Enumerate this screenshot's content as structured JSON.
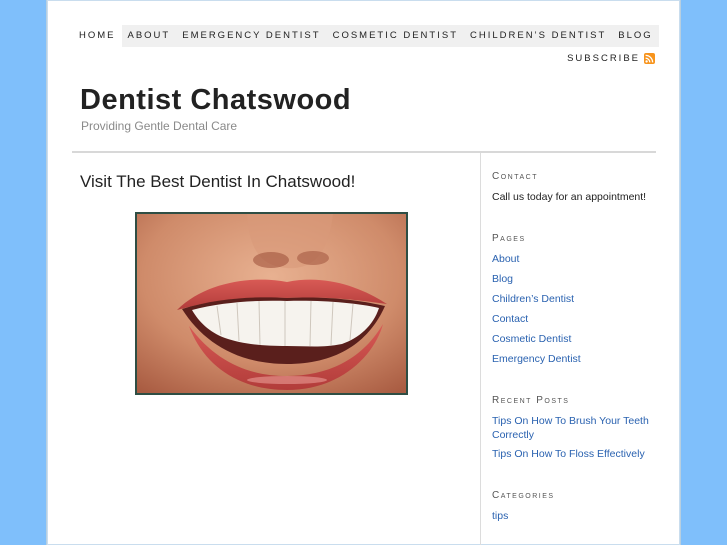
{
  "nav": {
    "items": [
      {
        "label": "Home"
      },
      {
        "label": "About"
      },
      {
        "label": "Emergency Dentist"
      },
      {
        "label": "Cosmetic Dentist"
      },
      {
        "label": "Children’s Dentist"
      },
      {
        "label": "Blog"
      }
    ],
    "subscribe_label": "Subscribe",
    "rss_icon": "rss-icon"
  },
  "header": {
    "site_title": "Dentist Chatswood",
    "tagline": "Providing Gentle Dental Care"
  },
  "post": {
    "title": "Visit The Best Dentist In Chatswood!",
    "image_subject": "smiling mouth with white teeth"
  },
  "sidebar": {
    "contact": {
      "title": "Contact",
      "text": "Call us today for an appointment!"
    },
    "pages": {
      "title": "Pages",
      "links": [
        "About",
        "Blog",
        "Children’s Dentist",
        "Contact",
        "Cosmetic Dentist",
        "Emergency Dentist"
      ]
    },
    "recent_posts": {
      "title": "Recent Posts",
      "links": [
        "Tips On How To Brush Your Teeth Correctly",
        "Tips On How To Floss Effectively"
      ]
    },
    "categories": {
      "title": "Categories",
      "links": [
        "tips"
      ]
    }
  },
  "colors": {
    "background": "#7fbffb",
    "link": "#2a62b0",
    "rss": "#f7941d"
  }
}
